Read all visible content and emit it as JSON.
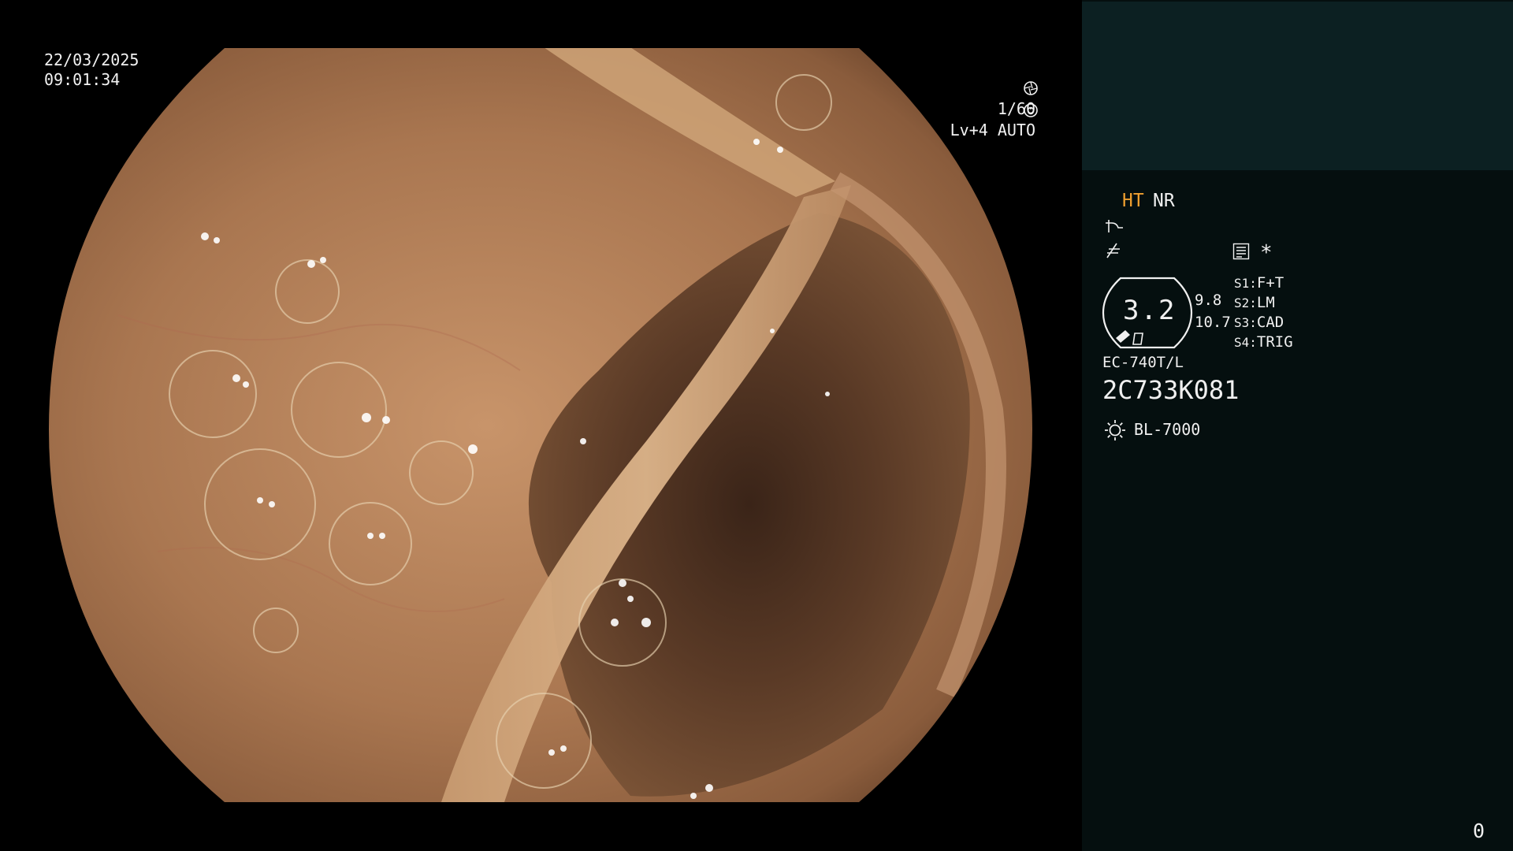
{
  "overlay": {
    "date": "22/03/2025",
    "time": "09:01:34",
    "shutter": "1/60",
    "iris": "Lv+4 AUTO"
  },
  "panel": {
    "ht": "HT",
    "nr": "NR",
    "asterisk": "*",
    "zoom_value": "3.2",
    "stat_top": "9.8",
    "stat_bottom": "10.7",
    "switches": [
      {
        "key": "S1:",
        "value": "F+T"
      },
      {
        "key": "S2:",
        "value": "LM"
      },
      {
        "key": "S3:",
        "value": "CAD"
      },
      {
        "key": "S4:",
        "value": "TRIG"
      }
    ],
    "scope_model": "EC-740T/L",
    "scope_serial": "2C733K081",
    "light_source": "BL-7000",
    "counter": "0"
  },
  "colors": {
    "panel_bg": "#050f0f",
    "thumb_bg": "#0c2022",
    "accent_orange": "#f0a030",
    "osd_text": "#f2f2f2"
  },
  "icons": {
    "shutter": "aperture-icon",
    "iris": "iris-icon",
    "enhancement": "enhancement-curve-icon",
    "color": "color-tone-icon",
    "menu": "menu-list-icon",
    "light": "light-source-icon",
    "zoom": "zoom-indicator-icon"
  }
}
